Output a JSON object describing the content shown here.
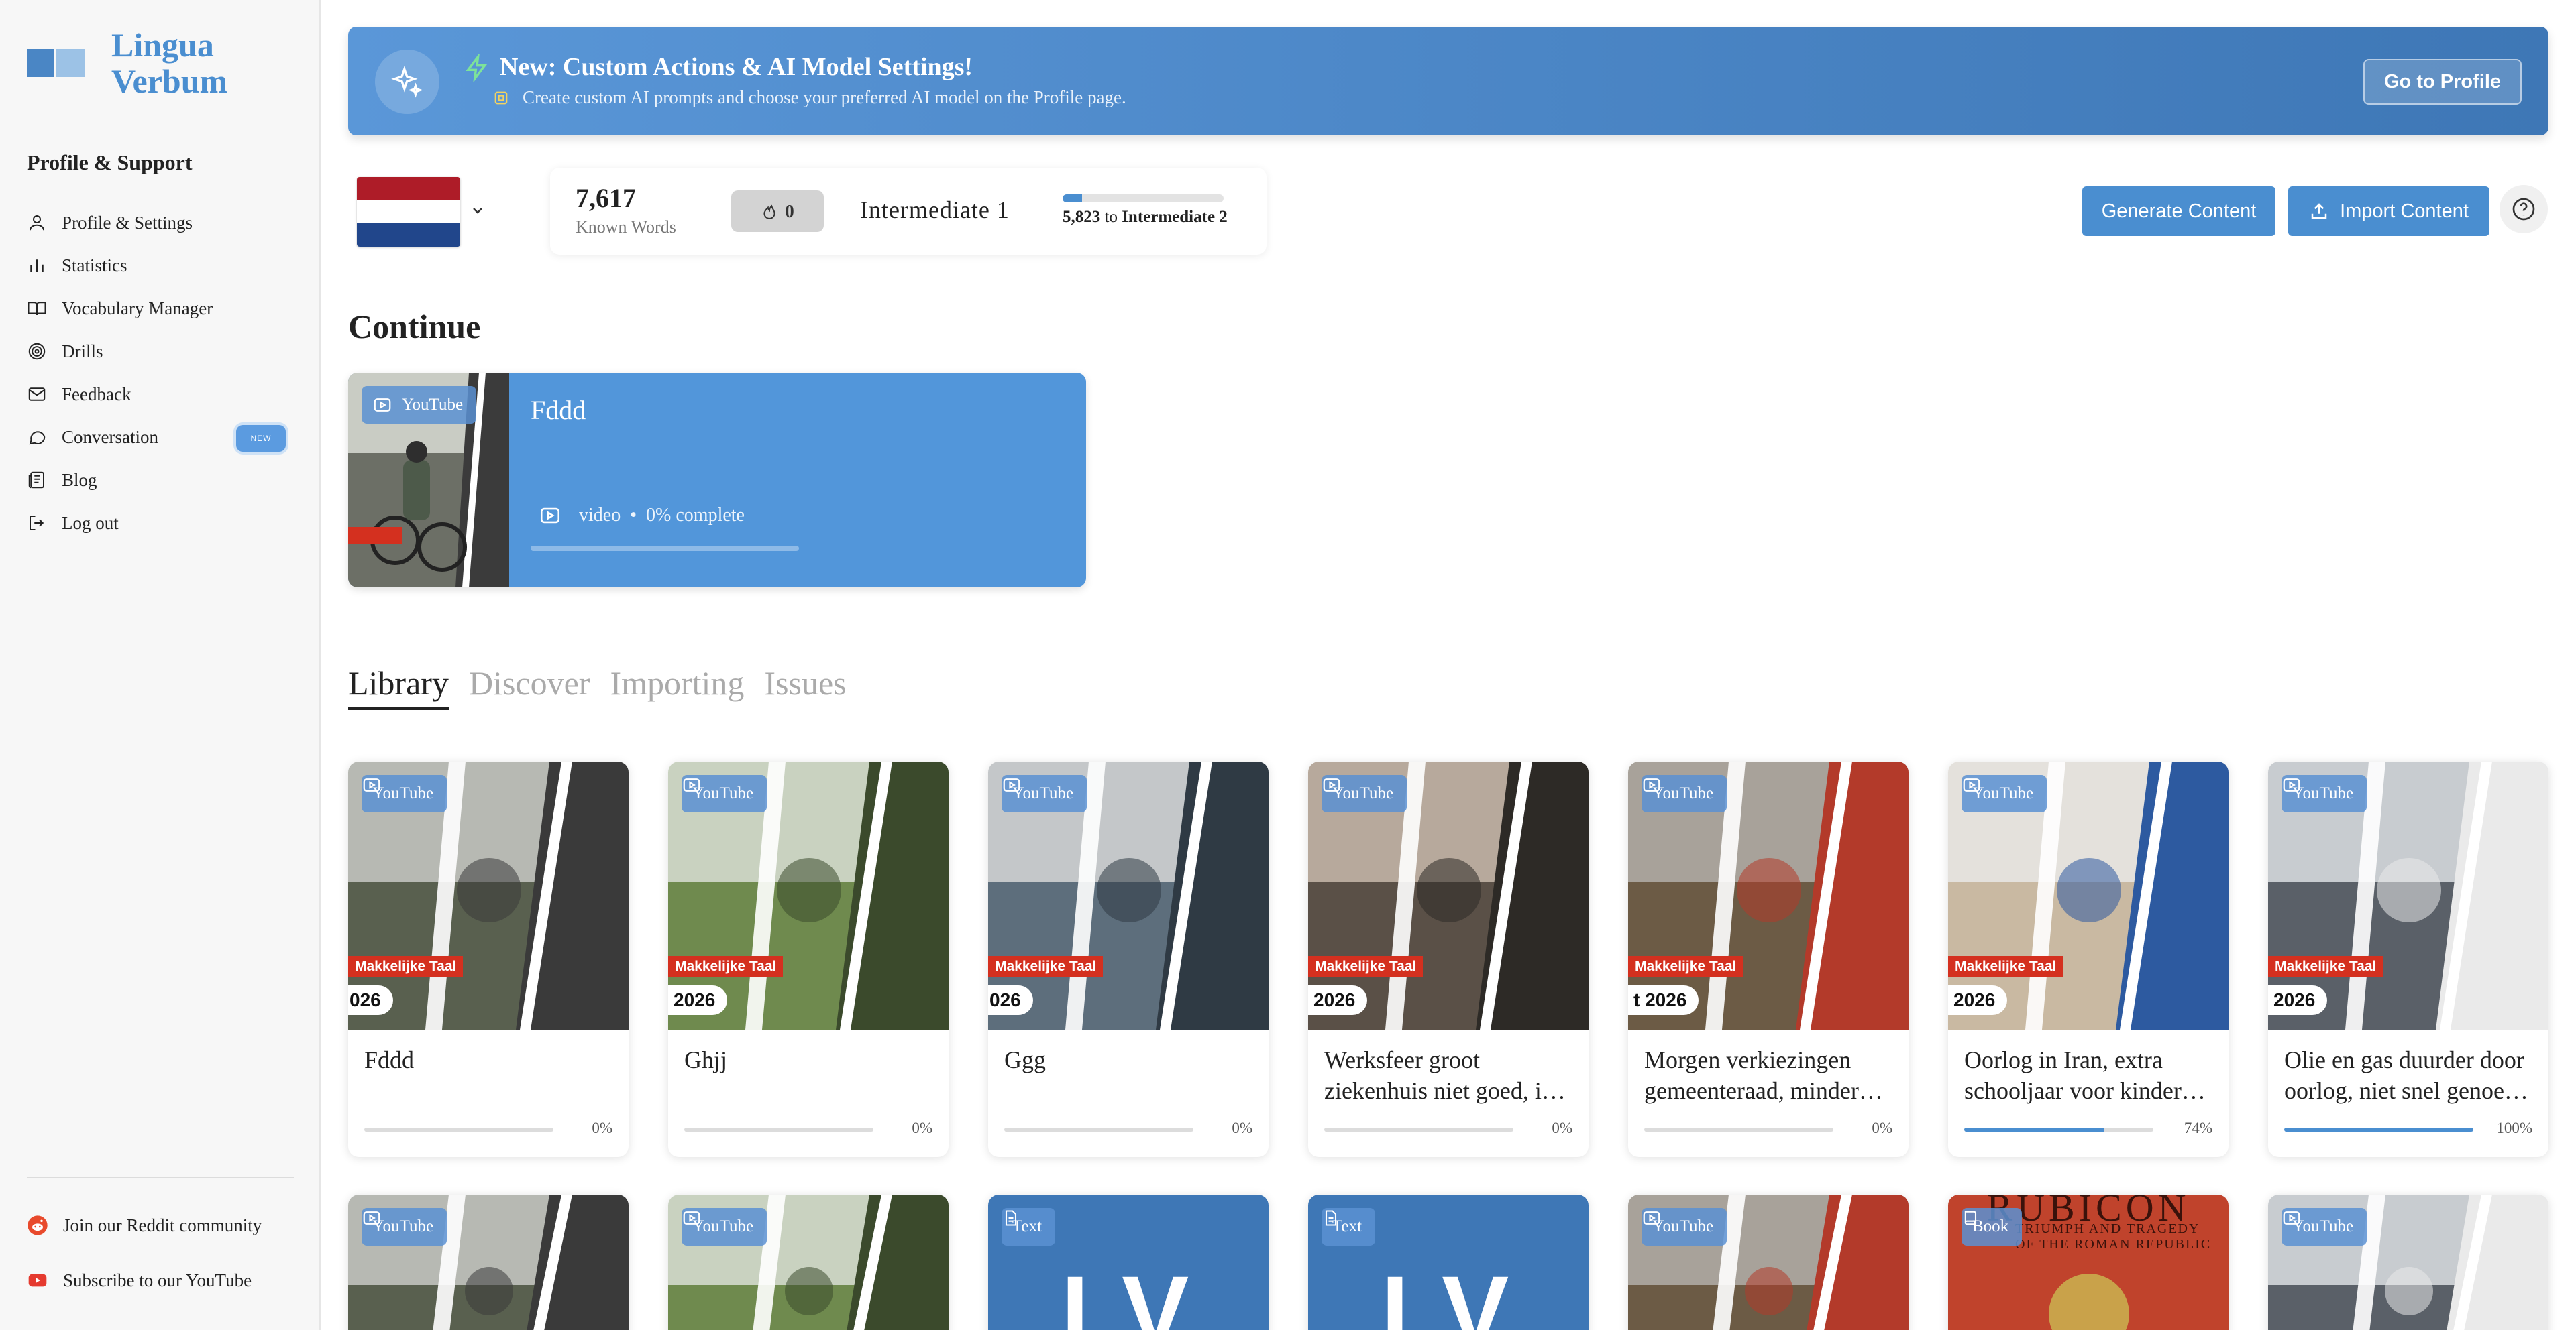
{
  "brand": {
    "name_line1": "Lingua",
    "name_line2": "Verbum"
  },
  "sidebar": {
    "heading": "Profile & Support",
    "items": [
      {
        "label": "Profile & Settings",
        "icon": "user-icon"
      },
      {
        "label": "Statistics",
        "icon": "bar-chart-icon"
      },
      {
        "label": "Vocabulary Manager",
        "icon": "book-icon"
      },
      {
        "label": "Drills",
        "icon": "target-icon"
      },
      {
        "label": "Feedback",
        "icon": "mail-icon"
      },
      {
        "label": "Conversation",
        "icon": "chat-icon",
        "badge": "NEW"
      },
      {
        "label": "Blog",
        "icon": "newspaper-icon"
      },
      {
        "label": "Log out",
        "icon": "logout-icon"
      }
    ],
    "footer": [
      {
        "label": "Join our Reddit community",
        "icon": "reddit-icon"
      },
      {
        "label": "Subscribe to our YouTube",
        "icon": "youtube-icon"
      }
    ]
  },
  "banner": {
    "title": "New: Custom Actions & AI Model Settings!",
    "subtitle": "Create custom AI prompts and choose your preferred AI model on the Profile page.",
    "button": "Go to Profile"
  },
  "stats": {
    "known_words": "7,617",
    "known_label": "Known Words",
    "streak": "0",
    "level": "Intermediate 1",
    "next_words": "5,823",
    "next_connector": "to",
    "next_level": "Intermediate 2",
    "progress": 0.12
  },
  "actions": {
    "generate": "Generate Content",
    "import": "Import Content"
  },
  "continue": {
    "heading": "Continue",
    "source": "YouTube",
    "title": "Fddd",
    "type": "video",
    "separator": "•",
    "progress_text": "0% complete",
    "progress": 0
  },
  "tabs": [
    "Library",
    "Discover",
    "Importing",
    "Issues"
  ],
  "library": {
    "tag_label": "Makkelijke Taal",
    "row1": [
      {
        "source": "YouTube",
        "year": "026",
        "title": "Fddd",
        "pct": "0%",
        "progress": 0
      },
      {
        "source": "YouTube",
        "year": "2026",
        "title": "Ghjj",
        "pct": "0%",
        "progress": 0
      },
      {
        "source": "YouTube",
        "year": "026",
        "title": "Ggg",
        "pct": "0%",
        "progress": 0
      },
      {
        "source": "YouTube",
        "year": "2026",
        "title": "Werksfeer groot ziekenhuis niet goed, i…",
        "pct": "0%",
        "progress": 0
      },
      {
        "source": "YouTube",
        "year": "t 2026",
        "title": "Morgen verkiezingen gemeenteraad, minder…",
        "pct": "0%",
        "progress": 0
      },
      {
        "source": "YouTube",
        "year": "2026",
        "title": "Oorlog in Iran, extra schooljaar voor kinder…",
        "pct": "74%",
        "progress": 0.74
      },
      {
        "source": "YouTube",
        "year": "2026",
        "title": "Olie en gas duurder door oorlog, niet snel genoe…",
        "pct": "100%",
        "progress": 1.0
      }
    ],
    "row2": [
      {
        "source": "YouTube"
      },
      {
        "source": "YouTube"
      },
      {
        "source": "Text",
        "logo": "LV"
      },
      {
        "source": "Text",
        "logo": "LV"
      },
      {
        "source": "YouTube"
      },
      {
        "source": "Book",
        "cover_text": "RUBICON",
        "cover_sub": "TRIUMPH AND TRAGEDY OF THE ROMAN REPUBLIC"
      },
      {
        "source": "YouTube"
      }
    ]
  },
  "colors": {
    "accent": "#4a8ed0",
    "banner": "#3e77b6",
    "tag_red": "#d4301f"
  }
}
